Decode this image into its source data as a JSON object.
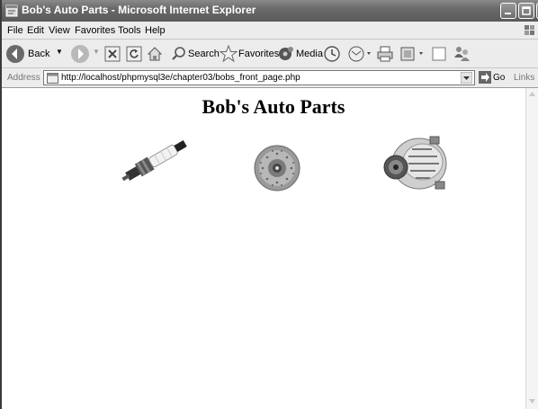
{
  "window": {
    "title": "Bob's Auto Parts - Microsoft Internet Explorer"
  },
  "menu": [
    "File",
    "Edit",
    "View",
    "Favorites",
    "Tools",
    "Help"
  ],
  "toolbar": {
    "back_label": "Back",
    "search_label": "Search",
    "favorites_label": "Favorites",
    "media_label": "Media"
  },
  "address": {
    "label": "Address",
    "url": "http://localhost/phpmysql3e/chapter03/bobs_front_page.php",
    "go_label": "Go",
    "links_label": "Links"
  },
  "page": {
    "heading": "Bob's Auto Parts",
    "products": [
      {
        "icon": "spark-plug-image"
      },
      {
        "icon": "brake-disc-image"
      },
      {
        "icon": "alternator-image"
      }
    ]
  }
}
